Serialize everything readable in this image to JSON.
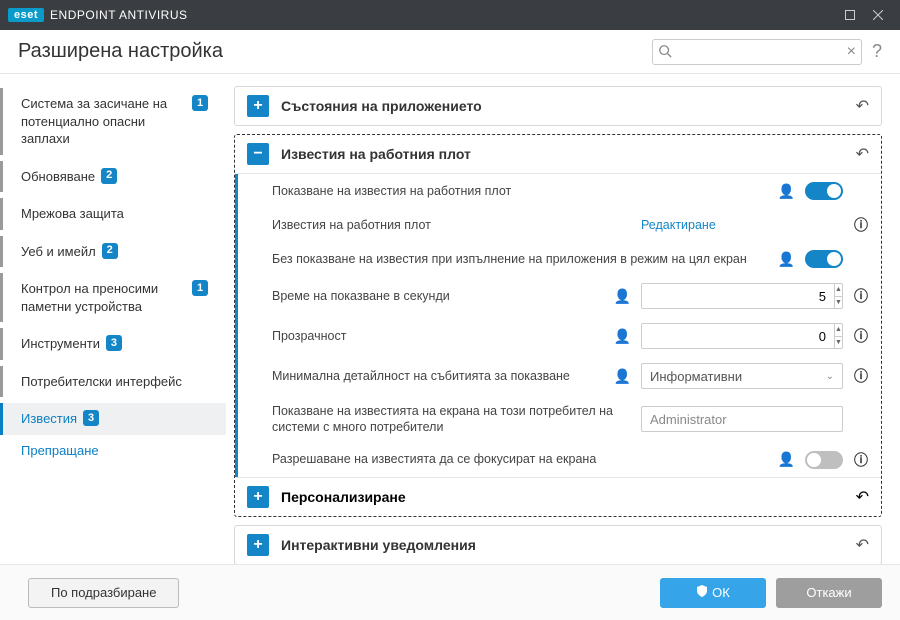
{
  "titlebar": {
    "brand": "eset",
    "title": "ENDPOINT ANTIVIRUS"
  },
  "header": {
    "title": "Разширена настройка",
    "search_placeholder": ""
  },
  "sidebar": {
    "items": [
      {
        "label": "Система за засичане на потенциално опасни заплахи",
        "badge": "1"
      },
      {
        "label": "Обновяване",
        "badge": "2"
      },
      {
        "label": "Мрежова защита",
        "badge": ""
      },
      {
        "label": "Уеб и имейл",
        "badge": "2"
      },
      {
        "label": "Контрол на преносими паметни устройства",
        "badge": "1"
      },
      {
        "label": "Инструменти",
        "badge": "3"
      },
      {
        "label": "Потребителски интерфейс",
        "badge": ""
      },
      {
        "label": "Известия",
        "badge": "3"
      }
    ],
    "sub": {
      "label": "Препращане"
    }
  },
  "sections": {
    "app_states": {
      "title": "Състояния на приложението"
    },
    "desktop_notifications": {
      "title": "Известия на работния плот",
      "rows": {
        "show_desktop": {
          "label": "Показване на известия на работния плот",
          "value": true
        },
        "edit": {
          "label": "Известия на работния плот",
          "action": "Редактиране"
        },
        "fullscreen": {
          "label": "Без показване на известия при изпълнение на приложения в режим на цял екран",
          "value": true
        },
        "seconds": {
          "label": "Време на показване в секунди",
          "value": "5"
        },
        "transparency": {
          "label": "Прозрачност",
          "value": "0"
        },
        "min_detail": {
          "label": "Минимална детайлност на събитията за показване",
          "value": "Информативни"
        },
        "show_user": {
          "label": "Показване на известията на екрана на този потребител на системи с много потребители",
          "value": "Administrator"
        },
        "allow_focus": {
          "label": "Разрешаване на известията да се фокусират на екрана",
          "value": false
        }
      },
      "personalize": {
        "title": "Персонализиране"
      }
    },
    "interactive": {
      "title": "Интерактивни уведомления"
    }
  },
  "footer": {
    "default": "По подразбиране",
    "ok": "ОК",
    "cancel": "Откажи"
  }
}
